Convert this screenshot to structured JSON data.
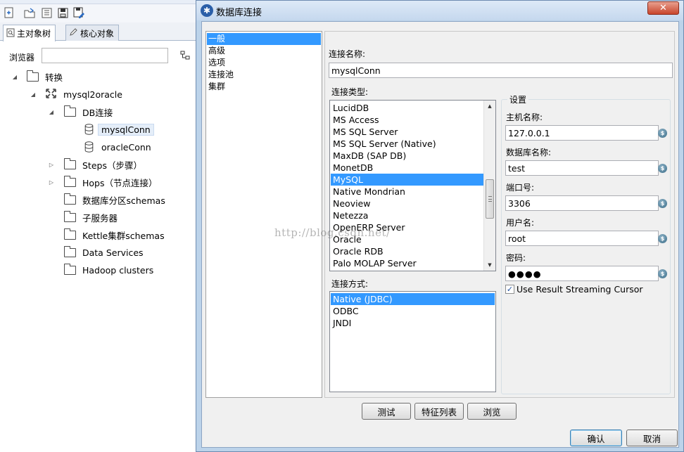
{
  "spoon": {
    "tabs": [
      {
        "label": "主对象树",
        "icon": "tree-icon"
      },
      {
        "label": "核心对象",
        "icon": "pencil-icon"
      }
    ],
    "browser_label": "浏览器",
    "search_value": "",
    "tree": [
      {
        "label": "转换",
        "icon": "folder-icon",
        "expanded": true,
        "level": 0
      },
      {
        "label": "mysql2oracle",
        "icon": "transformation-icon",
        "expanded": true,
        "level": 1
      },
      {
        "label": "DB连接",
        "icon": "folder-icon",
        "expanded": true,
        "level": 2
      },
      {
        "label": "mysqlConn",
        "icon": "database-icon",
        "level": 3,
        "selected": true
      },
      {
        "label": "oracleConn",
        "icon": "database-icon",
        "level": 3
      },
      {
        "label": "Steps（步骤）",
        "icon": "folder-icon",
        "expanded": false,
        "level": 2
      },
      {
        "label": "Hops（节点连接）",
        "icon": "folder-icon",
        "expanded": false,
        "level": 2
      },
      {
        "label": "数据库分区schemas",
        "icon": "folder-icon",
        "level": 2
      },
      {
        "label": "子服务器",
        "icon": "folder-icon",
        "level": 2
      },
      {
        "label": "Kettle集群schemas",
        "icon": "folder-icon",
        "level": 2
      },
      {
        "label": "Data Services",
        "icon": "folder-icon",
        "level": 2
      },
      {
        "label": "Hadoop clusters",
        "icon": "folder-icon",
        "level": 2
      }
    ]
  },
  "dialog": {
    "title": "数据库连接",
    "close_label": "✕",
    "categories": [
      "一般",
      "高级",
      "选项",
      "连接池",
      "集群"
    ],
    "selected_category": 0,
    "connection_name_label": "连接名称:",
    "connection_name_value": "mysqlConn",
    "connection_type_label": "连接类型:",
    "connection_types": [
      "LucidDB",
      "MS Access",
      "MS SQL Server",
      "MS SQL Server (Native)",
      "MaxDB (SAP DB)",
      "MonetDB",
      "MySQL",
      "Native Mondrian",
      "Neoview",
      "Netezza",
      "OpenERP Server",
      "Oracle",
      "Oracle RDB",
      "Palo MOLAP Server"
    ],
    "selected_connection_type": 6,
    "access_label": "连接方式:",
    "access_types": [
      "Native (JDBC)",
      "ODBC",
      "JNDI"
    ],
    "selected_access_type": 0,
    "settings": {
      "title": "设置",
      "host_label": "主机名称:",
      "host_value": "127.0.0.1",
      "dbname_label": "数据库名称:",
      "dbname_value": "test",
      "port_label": "端口号:",
      "port_value": "3306",
      "user_label": "用户名:",
      "user_value": "root",
      "password_label": "密码:",
      "password_value": "●●●●",
      "streaming_label": "Use Result Streaming Cursor",
      "streaming_checked": true,
      "variable_icon": "$"
    },
    "buttons": {
      "test": "测试",
      "features": "特征列表",
      "explore": "浏览",
      "ok": "确认",
      "cancel": "取消"
    }
  },
  "watermark": "http://blog.csdn.net/"
}
